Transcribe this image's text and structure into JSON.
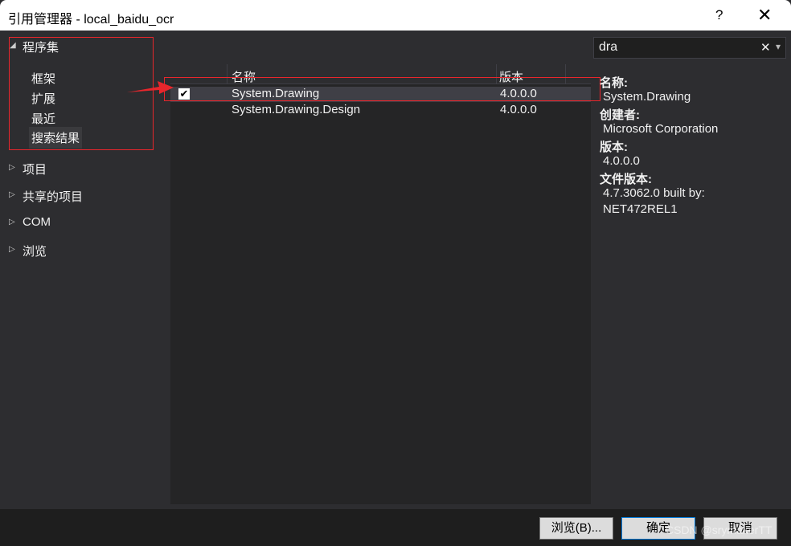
{
  "window": {
    "title": "引用管理器 - local_baidu_ocr",
    "help": "?",
    "close": "✕"
  },
  "nav": {
    "assemblies": "程序集",
    "sub": [
      "框架",
      "扩展",
      "最近",
      "搜索结果"
    ],
    "groups": [
      "项目",
      "共享的项目",
      "COM",
      "浏览"
    ]
  },
  "search": {
    "value": "dra",
    "clear": "✕",
    "dropdown": "▾"
  },
  "list": {
    "headers": [
      "名称",
      "版本"
    ],
    "rows": [
      {
        "name": "System.Drawing",
        "version": "4.0.0.0",
        "checked": true
      },
      {
        "name": "System.Drawing.Design",
        "version": "4.0.0.0",
        "checked": false
      }
    ]
  },
  "details": {
    "name_label": "名称:",
    "name": "System.Drawing",
    "creator_label": "创建者:",
    "creator": "Microsoft Corporation",
    "version_label": "版本:",
    "version": "4.0.0.0",
    "file_version_label": "文件版本:",
    "file_version_1": "4.7.3062.0 built by:",
    "file_version_2": "NET472REL1"
  },
  "buttons": {
    "browse": "浏览(B)...",
    "ok": "确定",
    "cancel": "取消"
  },
  "watermark": "CSDN @srymakerTT",
  "annotation_color": "#e8262c"
}
